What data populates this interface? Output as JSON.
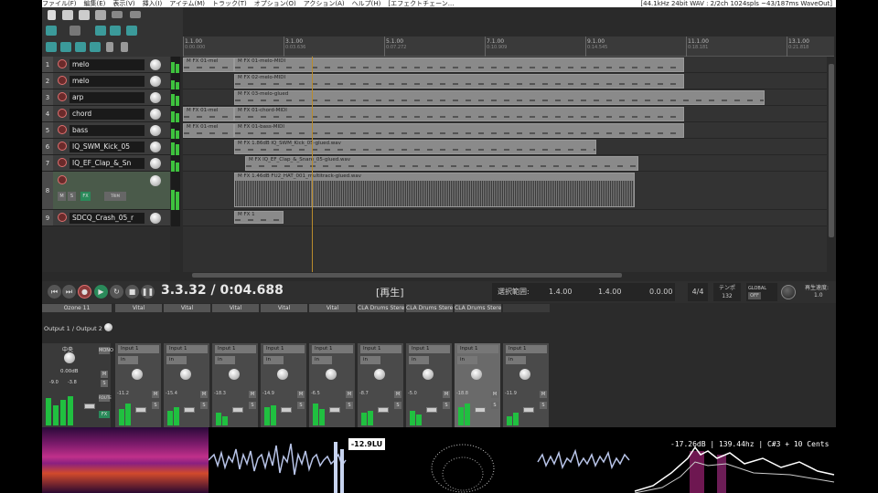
{
  "topbar": {
    "menu": [
      "ファイル(F)",
      "編集(E)",
      "表示(V)",
      "挿入(I)",
      "アイテム(M)",
      "トラック(T)",
      "オプション(O)",
      "アクション(A)",
      "ヘルプ(H)",
      "[エフェクトチェーン..."
    ],
    "info": "[44.1kHz 24bit WAV : 2/2ch 1024spls ~43/187ms WaveOut]"
  },
  "ruler": {
    "marks": [
      {
        "bar": "1.1.00",
        "time": "0:00.000"
      },
      {
        "bar": "3.1.00",
        "time": "0:03.636"
      },
      {
        "bar": "5.1.00",
        "time": "0:07.272"
      },
      {
        "bar": "7.1.00",
        "time": "0:10.909"
      },
      {
        "bar": "9.1.00",
        "time": "0:14.545"
      },
      {
        "bar": "11.1.00",
        "time": "0:18.181"
      },
      {
        "bar": "13.1.00",
        "time": "0:21.818"
      }
    ]
  },
  "tracks": [
    {
      "num": "1",
      "name": "melo"
    },
    {
      "num": "2",
      "name": "melo"
    },
    {
      "num": "3",
      "name": "arp"
    },
    {
      "num": "4",
      "name": "chord"
    },
    {
      "num": "5",
      "name": "bass"
    },
    {
      "num": "6",
      "name": "IQ_SWM_Kick_05"
    },
    {
      "num": "7",
      "name": "IQ_EF_Clap_&_Sn"
    },
    {
      "num": "8",
      "name": ""
    },
    {
      "num": "9",
      "name": "SDCQ_Crash_05_r"
    }
  ],
  "track8_controls": {
    "m": "M",
    "s": "S",
    "fx": "FX",
    "trim": "TRIM"
  },
  "items": [
    {
      "label": "M FX 01-mel",
      "track": 0
    },
    {
      "label": "M FX 01-melo-MIDI",
      "track": 0
    },
    {
      "label": "M FX 02-melo-MIDI",
      "track": 1
    },
    {
      "label": "M FX 03-melo-glued",
      "track": 2
    },
    {
      "label": "M FX 01-mel",
      "track": 3
    },
    {
      "label": "M FX 01-chord-MIDI",
      "track": 3
    },
    {
      "label": "M FX 01-mel",
      "track": 4
    },
    {
      "label": "M FX 01-bass-MIDI",
      "track": 4
    },
    {
      "label": "M FX 1.86dB IQ_SWM_Kick_05-glued.wav",
      "track": 5
    },
    {
      "label": "M FX IQ_EF_Clap_&_Snare_05-glued.wav",
      "track": 6
    },
    {
      "label": "M FX 1.46dB FU2_HAT_001_multitrack-glued.wav",
      "track": 7
    },
    {
      "label": "M FX 1",
      "track": 8
    }
  ],
  "transport": {
    "timecode": "3.3.32 / 0:04.688",
    "status": "[再生]",
    "selection_label": "選択範囲:",
    "sel_start": "1.4.00",
    "sel_end": "1.4.00",
    "sel_len": "0.0.00",
    "timesig": "4/4",
    "tempo_label": "テンポ",
    "tempo": "132",
    "global_label": "GLOBAL",
    "global_state": "OFF",
    "rate_label": "再生速度:",
    "rate": "1.0"
  },
  "mixer": {
    "master": {
      "fx": "Ozone 11",
      "output": "Output 1 / Output 2",
      "pan_label": "中央",
      "db": "0.00dB",
      "peak_l": "-9.0",
      "peak_r": "-3.8",
      "mono": "MONO",
      "route": "ROUTE",
      "fx_btn": "FX"
    },
    "strips": [
      {
        "fx": "Vital",
        "input": "Input 1",
        "vu": "-11.2"
      },
      {
        "fx": "Vital",
        "input": "Input 1",
        "vu": "-15.4"
      },
      {
        "fx": "Vital",
        "input": "Input 1",
        "vu": "-18.3"
      },
      {
        "fx": "Vital",
        "input": "Input 1",
        "vu": "-14.9"
      },
      {
        "fx": "Vital",
        "input": "Input 1",
        "vu": "-6.5"
      },
      {
        "fx": "CLA Drums Stere",
        "input": "Input 1",
        "vu": "-8.7"
      },
      {
        "fx": "CLA Drums Stere",
        "input": "Input 1",
        "vu": "-5.0"
      },
      {
        "fx": "CLA Drums Stere",
        "input": "Input 1",
        "vu": "-18.8"
      },
      {
        "fx": "",
        "input": "Input 1",
        "vu": "-11.9"
      }
    ]
  },
  "visualizer": {
    "lufs": "-12.9LU",
    "spectrum_info": "-17.26dB | 139.44hz | C#3 + 10 Cents"
  }
}
